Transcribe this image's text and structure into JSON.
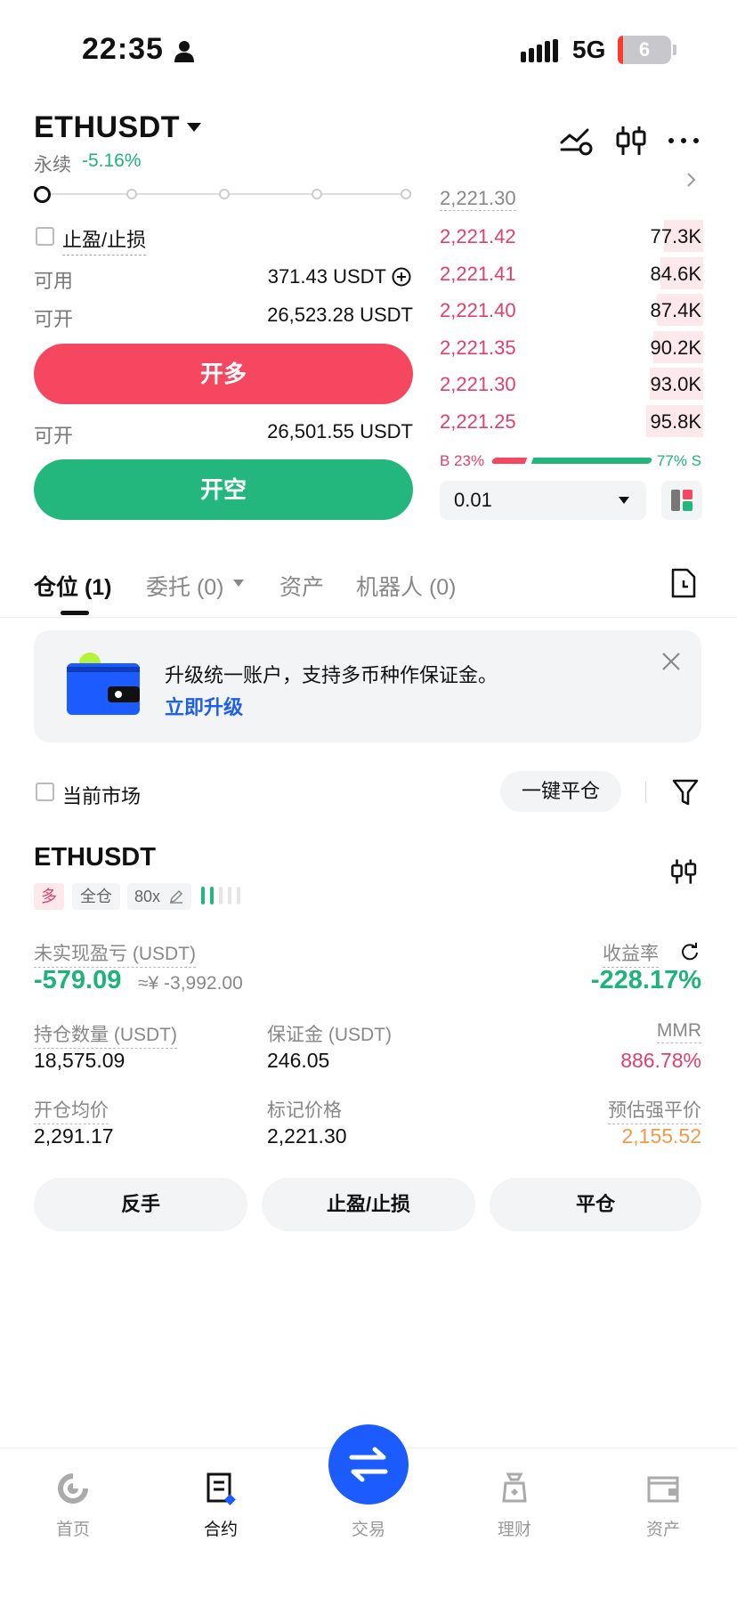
{
  "status_bar": {
    "time": "22:35",
    "network": "5G",
    "battery": "6"
  },
  "header": {
    "pair": "ETHUSDT",
    "contract_type": "永续",
    "change": "-5.16%"
  },
  "order_form": {
    "tpsl_label": "止盈/止损",
    "available_label": "可用",
    "available_value": "371.43 USDT",
    "open_long_label": "可开",
    "open_long_value": "26,523.28 USDT",
    "long_button": "开多",
    "open_short_label": "可开",
    "open_short_value": "26,501.55 USDT",
    "short_button": "开空"
  },
  "order_book": {
    "last_price": "2,221.30",
    "asks": [
      {
        "price": "2,221.42",
        "qty": "77.3K"
      },
      {
        "price": "2,221.41",
        "qty": "84.6K"
      },
      {
        "price": "2,221.40",
        "qty": "87.4K"
      },
      {
        "price": "2,221.35",
        "qty": "90.2K"
      },
      {
        "price": "2,221.30",
        "qty": "93.0K"
      },
      {
        "price": "2,221.25",
        "qty": "95.8K"
      }
    ],
    "buy_ratio": "B 23%",
    "sell_ratio": "77% S",
    "buy_pct": 0.23,
    "precision": "0.01"
  },
  "tabs": [
    {
      "label": "仓位 (1)"
    },
    {
      "label": "委托 (0)"
    },
    {
      "label": "资产"
    },
    {
      "label": "机器人 (0)"
    }
  ],
  "banner": {
    "title": "升级统一账户，支持多币种作保证金。",
    "link": "立即升级"
  },
  "filter": {
    "current_market": "当前市场",
    "close_all": "一键平仓"
  },
  "position": {
    "symbol": "ETHUSDT",
    "side": "多",
    "margin_mode": "全仓",
    "leverage": "80x",
    "upnl_label": "未实现盈亏 (USDT)",
    "upnl_value": "-579.09",
    "upnl_cny": "≈¥ -3,992.00",
    "roe_label": "收益率",
    "roe_value": "-228.17%",
    "size_label": "持仓数量 (USDT)",
    "size_value": "18,575.09",
    "margin_label": "保证金 (USDT)",
    "margin_value": "246.05",
    "mmr_label": "MMR",
    "mmr_value": "886.78%",
    "entry_label": "开仓均价",
    "entry_value": "2,291.17",
    "mark_label": "标记价格",
    "mark_value": "2,221.30",
    "liq_label": "预估强平价",
    "liq_value": "2,155.52",
    "btn_reverse": "反手",
    "btn_tpsl": "止盈/止损",
    "btn_close": "平仓"
  },
  "nav": [
    {
      "label": "首页"
    },
    {
      "label": "合约"
    },
    {
      "label": "交易"
    },
    {
      "label": "理财"
    },
    {
      "label": "资产"
    }
  ],
  "colors": {
    "long": "#f5475f",
    "short": "#23b77d",
    "accent": "#1c5cff"
  }
}
